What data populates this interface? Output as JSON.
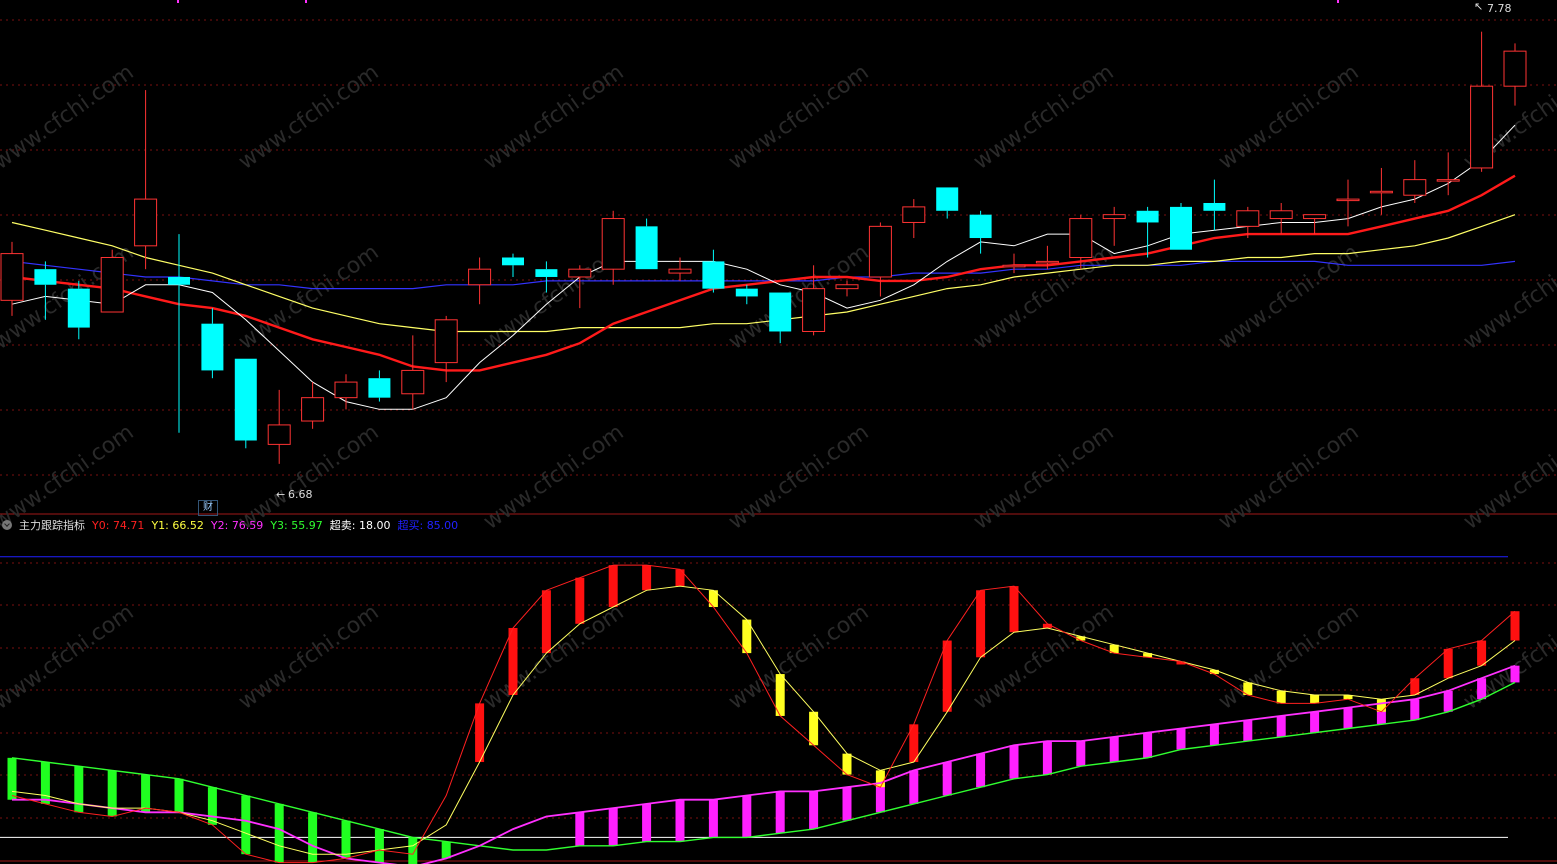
{
  "indicator": {
    "name": "主力跟踪指标",
    "items": [
      {
        "label": "Y0:",
        "value": "74.71",
        "color": "#ff2020"
      },
      {
        "label": "Y1:",
        "value": "66.52",
        "color": "#ffff40"
      },
      {
        "label": "Y2:",
        "value": "76.59",
        "color": "#ff30ff"
      },
      {
        "label": "Y3:",
        "value": "55.97",
        "color": "#30ff30"
      },
      {
        "label": "超卖:",
        "value": "18.00",
        "color": "#ffffff"
      },
      {
        "label": "超买:",
        "value": "85.00",
        "color": "#2020ff"
      }
    ]
  },
  "badge": "财",
  "annotations": {
    "high": "7.78",
    "low": "6.68"
  },
  "colors": {
    "up": "#ff3333",
    "down": "#00ffff",
    "grid": "#7a1010",
    "ma5": "#ffffff",
    "ma10": "#ff1a1a",
    "ma20": "#ffff66",
    "ma60": "#3333ff"
  },
  "chart_data": [
    {
      "type": "candlestick",
      "ylim": [
        6.6,
        7.82
      ],
      "candles": [
        {
          "o": 7.1,
          "c": 7.22,
          "h": 7.25,
          "l": 7.06
        },
        {
          "o": 7.18,
          "c": 7.14,
          "h": 7.2,
          "l": 7.05
        },
        {
          "o": 7.13,
          "c": 7.03,
          "h": 7.15,
          "l": 7.0
        },
        {
          "o": 7.07,
          "c": 7.21,
          "h": 7.23,
          "l": 7.07
        },
        {
          "o": 7.24,
          "c": 7.36,
          "h": 7.64,
          "l": 7.18
        },
        {
          "o": 7.16,
          "c": 7.14,
          "h": 7.27,
          "l": 6.76
        },
        {
          "o": 7.04,
          "c": 6.92,
          "h": 7.08,
          "l": 6.9
        },
        {
          "o": 6.95,
          "c": 6.74,
          "h": 6.95,
          "l": 6.72
        },
        {
          "o": 6.73,
          "c": 6.78,
          "h": 6.87,
          "l": 6.68
        },
        {
          "o": 6.79,
          "c": 6.85,
          "h": 6.89,
          "l": 6.77
        },
        {
          "o": 6.85,
          "c": 6.89,
          "h": 6.91,
          "l": 6.82
        },
        {
          "o": 6.9,
          "c": 6.85,
          "h": 6.92,
          "l": 6.84
        },
        {
          "o": 6.86,
          "c": 6.92,
          "h": 7.01,
          "l": 6.82
        },
        {
          "o": 6.94,
          "c": 7.05,
          "h": 7.06,
          "l": 6.89
        },
        {
          "o": 7.14,
          "c": 7.18,
          "h": 7.21,
          "l": 7.09
        },
        {
          "o": 7.21,
          "c": 7.19,
          "h": 7.22,
          "l": 7.16
        },
        {
          "o": 7.18,
          "c": 7.16,
          "h": 7.2,
          "l": 7.12
        },
        {
          "o": 7.16,
          "c": 7.18,
          "h": 7.19,
          "l": 7.08
        },
        {
          "o": 7.18,
          "c": 7.31,
          "h": 7.33,
          "l": 7.14
        },
        {
          "o": 7.29,
          "c": 7.18,
          "h": 7.31,
          "l": 7.18
        },
        {
          "o": 7.17,
          "c": 7.18,
          "h": 7.21,
          "l": 7.15
        },
        {
          "o": 7.2,
          "c": 7.13,
          "h": 7.23,
          "l": 7.12
        },
        {
          "o": 7.13,
          "c": 7.11,
          "h": 7.14,
          "l": 7.09
        },
        {
          "o": 7.12,
          "c": 7.02,
          "h": 7.12,
          "l": 6.99
        },
        {
          "o": 7.02,
          "c": 7.13,
          "h": 7.19,
          "l": 7.01
        },
        {
          "o": 7.13,
          "c": 7.14,
          "h": 7.15,
          "l": 7.11
        },
        {
          "o": 7.16,
          "c": 7.29,
          "h": 7.3,
          "l": 7.11
        },
        {
          "o": 7.3,
          "c": 7.34,
          "h": 7.36,
          "l": 7.26
        },
        {
          "o": 7.39,
          "c": 7.33,
          "h": 7.39,
          "l": 7.31
        },
        {
          "o": 7.32,
          "c": 7.26,
          "h": 7.33,
          "l": 7.22
        },
        {
          "o": 7.19,
          "c": 7.19,
          "h": 7.22,
          "l": 7.17
        },
        {
          "o": 7.2,
          "c": 7.2,
          "h": 7.24,
          "l": 7.18
        },
        {
          "o": 7.21,
          "c": 7.31,
          "h": 7.32,
          "l": 7.18
        },
        {
          "o": 7.31,
          "c": 7.32,
          "h": 7.34,
          "l": 7.24
        },
        {
          "o": 7.33,
          "c": 7.3,
          "h": 7.34,
          "l": 7.21
        },
        {
          "o": 7.34,
          "c": 7.23,
          "h": 7.35,
          "l": 7.23
        },
        {
          "o": 7.35,
          "c": 7.33,
          "h": 7.41,
          "l": 7.28
        },
        {
          "o": 7.29,
          "c": 7.33,
          "h": 7.34,
          "l": 7.26
        },
        {
          "o": 7.31,
          "c": 7.33,
          "h": 7.35,
          "l": 7.27
        },
        {
          "o": 7.31,
          "c": 7.32,
          "h": 7.32,
          "l": 7.27
        },
        {
          "o": 7.36,
          "c": 7.36,
          "h": 7.41,
          "l": 7.29
        },
        {
          "o": 7.38,
          "c": 7.38,
          "h": 7.44,
          "l": 7.32
        },
        {
          "o": 7.37,
          "c": 7.41,
          "h": 7.46,
          "l": 7.35
        },
        {
          "o": 7.41,
          "c": 7.41,
          "h": 7.48,
          "l": 7.37
        },
        {
          "o": 7.44,
          "c": 7.65,
          "h": 7.79,
          "l": 7.43
        },
        {
          "o": 7.65,
          "c": 7.74,
          "h": 7.76,
          "l": 7.6
        }
      ],
      "ma5": [
        7.09,
        7.11,
        7.1,
        7.09,
        7.14,
        7.14,
        7.12,
        7.05,
        6.97,
        6.89,
        6.84,
        6.82,
        6.82,
        6.85,
        6.94,
        7.01,
        7.09,
        7.16,
        7.2,
        7.2,
        7.2,
        7.2,
        7.18,
        7.14,
        7.12,
        7.08,
        7.1,
        7.14,
        7.2,
        7.25,
        7.24,
        7.27,
        7.27,
        7.22,
        7.24,
        7.27,
        7.28,
        7.29,
        7.3,
        7.3,
        7.31,
        7.34,
        7.36,
        7.4,
        7.46,
        7.55
      ],
      "ma10": [
        7.16,
        7.15,
        7.14,
        7.13,
        7.11,
        7.09,
        7.08,
        7.06,
        7.03,
        7.0,
        6.98,
        6.96,
        6.93,
        6.92,
        6.92,
        6.94,
        6.96,
        6.99,
        7.04,
        7.07,
        7.1,
        7.13,
        7.14,
        7.15,
        7.16,
        7.16,
        7.15,
        7.15,
        7.16,
        7.18,
        7.19,
        7.19,
        7.2,
        7.21,
        7.22,
        7.24,
        7.26,
        7.27,
        7.27,
        7.27,
        7.27,
        7.29,
        7.31,
        7.33,
        7.37,
        7.42
      ],
      "ma20": [
        7.3,
        7.28,
        7.26,
        7.24,
        7.21,
        7.19,
        7.17,
        7.14,
        7.11,
        7.08,
        7.06,
        7.04,
        7.03,
        7.02,
        7.02,
        7.02,
        7.02,
        7.03,
        7.03,
        7.03,
        7.03,
        7.04,
        7.04,
        7.05,
        7.06,
        7.07,
        7.09,
        7.11,
        7.13,
        7.14,
        7.16,
        7.17,
        7.18,
        7.19,
        7.19,
        7.2,
        7.2,
        7.21,
        7.21,
        7.22,
        7.22,
        7.23,
        7.24,
        7.26,
        7.29,
        7.32
      ],
      "ma60": [
        7.2,
        7.19,
        7.18,
        7.17,
        7.16,
        7.16,
        7.15,
        7.14,
        7.14,
        7.13,
        7.13,
        7.13,
        7.13,
        7.14,
        7.14,
        7.14,
        7.15,
        7.15,
        7.15,
        7.15,
        7.15,
        7.15,
        7.15,
        7.15,
        7.15,
        7.16,
        7.16,
        7.17,
        7.17,
        7.17,
        7.18,
        7.18,
        7.19,
        7.19,
        7.19,
        7.19,
        7.2,
        7.2,
        7.2,
        7.2,
        7.19,
        7.19,
        7.19,
        7.19,
        7.19,
        7.2
      ]
    },
    {
      "type": "bar",
      "ylim": [
        15,
        89
      ],
      "series_names": [
        "Y0",
        "Y1",
        "Y2",
        "Y3",
        "超卖",
        "超买"
      ],
      "Y0": [
        28,
        26,
        24,
        23,
        25,
        24,
        21,
        14,
        12,
        12,
        13,
        15,
        14,
        28,
        50,
        68,
        77,
        80,
        83,
        83,
        82,
        73,
        62,
        47,
        40,
        33,
        30,
        45,
        65,
        77,
        78,
        69,
        65,
        62,
        61,
        60,
        57,
        52,
        50,
        50,
        51,
        48,
        56,
        63,
        65,
        72
      ],
      "Y1": [
        29,
        28,
        26,
        25,
        25,
        24,
        22,
        19,
        16,
        14,
        14,
        15,
        16,
        21,
        36,
        52,
        62,
        69,
        73,
        77,
        78,
        77,
        70,
        57,
        48,
        38,
        34,
        36,
        48,
        61,
        67,
        68,
        66,
        64,
        62,
        60,
        58,
        55,
        53,
        52,
        52,
        51,
        52,
        56,
        59,
        65
      ],
      "Y2": [
        27,
        27,
        26,
        25,
        24,
        24,
        23,
        22,
        20,
        16,
        13,
        12,
        11,
        13,
        16,
        20,
        23,
        24,
        25,
        26,
        27,
        27,
        28,
        29,
        29,
        30,
        31,
        34,
        36,
        38,
        40,
        41,
        41,
        42,
        43,
        44,
        45,
        46,
        47,
        48,
        49,
        50,
        51,
        53,
        56,
        59
      ],
      "Y3": [
        37,
        36,
        35,
        34,
        33,
        32,
        30,
        28,
        26,
        24,
        22,
        20,
        18,
        17,
        16,
        15,
        15,
        16,
        16,
        17,
        17,
        18,
        18,
        19,
        20,
        22,
        24,
        26,
        28,
        30,
        32,
        33,
        35,
        36,
        37,
        39,
        40,
        41,
        42,
        43,
        44,
        45,
        46,
        48,
        51,
        55
      ],
      "oversold": 18,
      "overbought": 85
    }
  ]
}
